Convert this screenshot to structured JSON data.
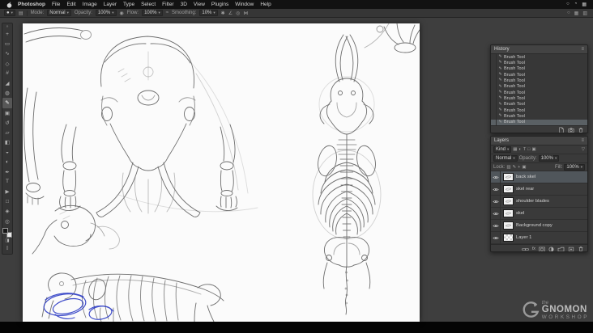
{
  "menubar": {
    "app_menus": [
      "Photoshop",
      "File",
      "Edit",
      "Image",
      "Layer",
      "Type",
      "Select",
      "Filter",
      "3D",
      "View",
      "Plugins",
      "Window",
      "Help"
    ],
    "status_icons": {
      "search": "○",
      "control_center": "◔",
      "extras": "▦"
    }
  },
  "options_bar": {
    "mode_label": "Mode:",
    "mode_value": "Normal",
    "opacity_label": "Opacity:",
    "opacity_value": "100%",
    "flow_label": "Flow:",
    "flow_value": "100%",
    "smoothing_label": "Smoothing:",
    "smoothing_value": "10%"
  },
  "toolbar": {
    "collapse_glyph": "»",
    "tools": [
      {
        "tool": "move-tool",
        "glyph": "+"
      },
      {
        "tool": "marquee-tool",
        "glyph": "▭"
      },
      {
        "tool": "lasso-tool",
        "glyph": "∿"
      },
      {
        "tool": "quick-selection-tool",
        "glyph": "◇"
      },
      {
        "tool": "crop-tool",
        "glyph": "#"
      },
      {
        "tool": "eyedropper-tool",
        "glyph": "◢"
      },
      {
        "tool": "healing-brush-tool",
        "glyph": "◍"
      },
      {
        "tool": "brush-tool",
        "glyph": "✎",
        "selected": true
      },
      {
        "tool": "clone-stamp-tool",
        "glyph": "▣"
      },
      {
        "tool": "history-brush-tool",
        "glyph": "↺"
      },
      {
        "tool": "eraser-tool",
        "glyph": "▱"
      },
      {
        "tool": "gradient-tool",
        "glyph": "◧"
      },
      {
        "tool": "blur-tool",
        "glyph": "◒"
      },
      {
        "tool": "dodge-tool",
        "glyph": "◐"
      },
      {
        "tool": "pen-tool",
        "glyph": "✒"
      },
      {
        "tool": "type-tool",
        "glyph": "T"
      },
      {
        "tool": "path-selection-tool",
        "glyph": "▶"
      },
      {
        "tool": "shape-tool",
        "glyph": "□"
      },
      {
        "tool": "hand-tool",
        "glyph": "◈"
      },
      {
        "tool": "zoom-tool",
        "glyph": "◎"
      }
    ]
  },
  "history_panel": {
    "title": "History",
    "entries": [
      {
        "label": "Brush Tool"
      },
      {
        "label": "Brush Tool"
      },
      {
        "label": "Brush Tool"
      },
      {
        "label": "Brush Tool"
      },
      {
        "label": "Brush Tool"
      },
      {
        "label": "Brush Tool"
      },
      {
        "label": "Brush Tool"
      },
      {
        "label": "Brush Tool"
      },
      {
        "label": "Brush Tool"
      },
      {
        "label": "Brush Tool"
      },
      {
        "label": "Brush Tool"
      },
      {
        "label": "Brush Tool",
        "selected": true
      }
    ]
  },
  "layers_panel": {
    "title": "Layers",
    "filter_label": "Kind",
    "blend_mode": "Normal",
    "opacity_label": "Opacity:",
    "opacity_value": "100%",
    "lock_label": "Lock:",
    "fill_label": "Fill:",
    "fill_value": "100%",
    "layers": [
      {
        "name": "back skel",
        "selected": true,
        "thumb": "sketch"
      },
      {
        "name": "skel rear",
        "thumb": "sketch"
      },
      {
        "name": "shoulder blades",
        "thumb": "sketch"
      },
      {
        "name": "skel",
        "thumb": "sketch"
      },
      {
        "name": "Background copy",
        "thumb": "sketch"
      },
      {
        "name": "Layer 1",
        "thumb": "checker"
      }
    ]
  },
  "watermark": {
    "prefix": "the",
    "name": "GNOMON",
    "suffix": "WORKSHOP"
  },
  "colors": {
    "selection_highlight": "#50565b",
    "history_highlight": "#5a6064",
    "ink_blue": "#2b3bc4",
    "pencil_gray": "#6d6d6d",
    "canvas": "#fbfbfb",
    "panel": "#3a3a3a",
    "menubar": "#121212"
  }
}
